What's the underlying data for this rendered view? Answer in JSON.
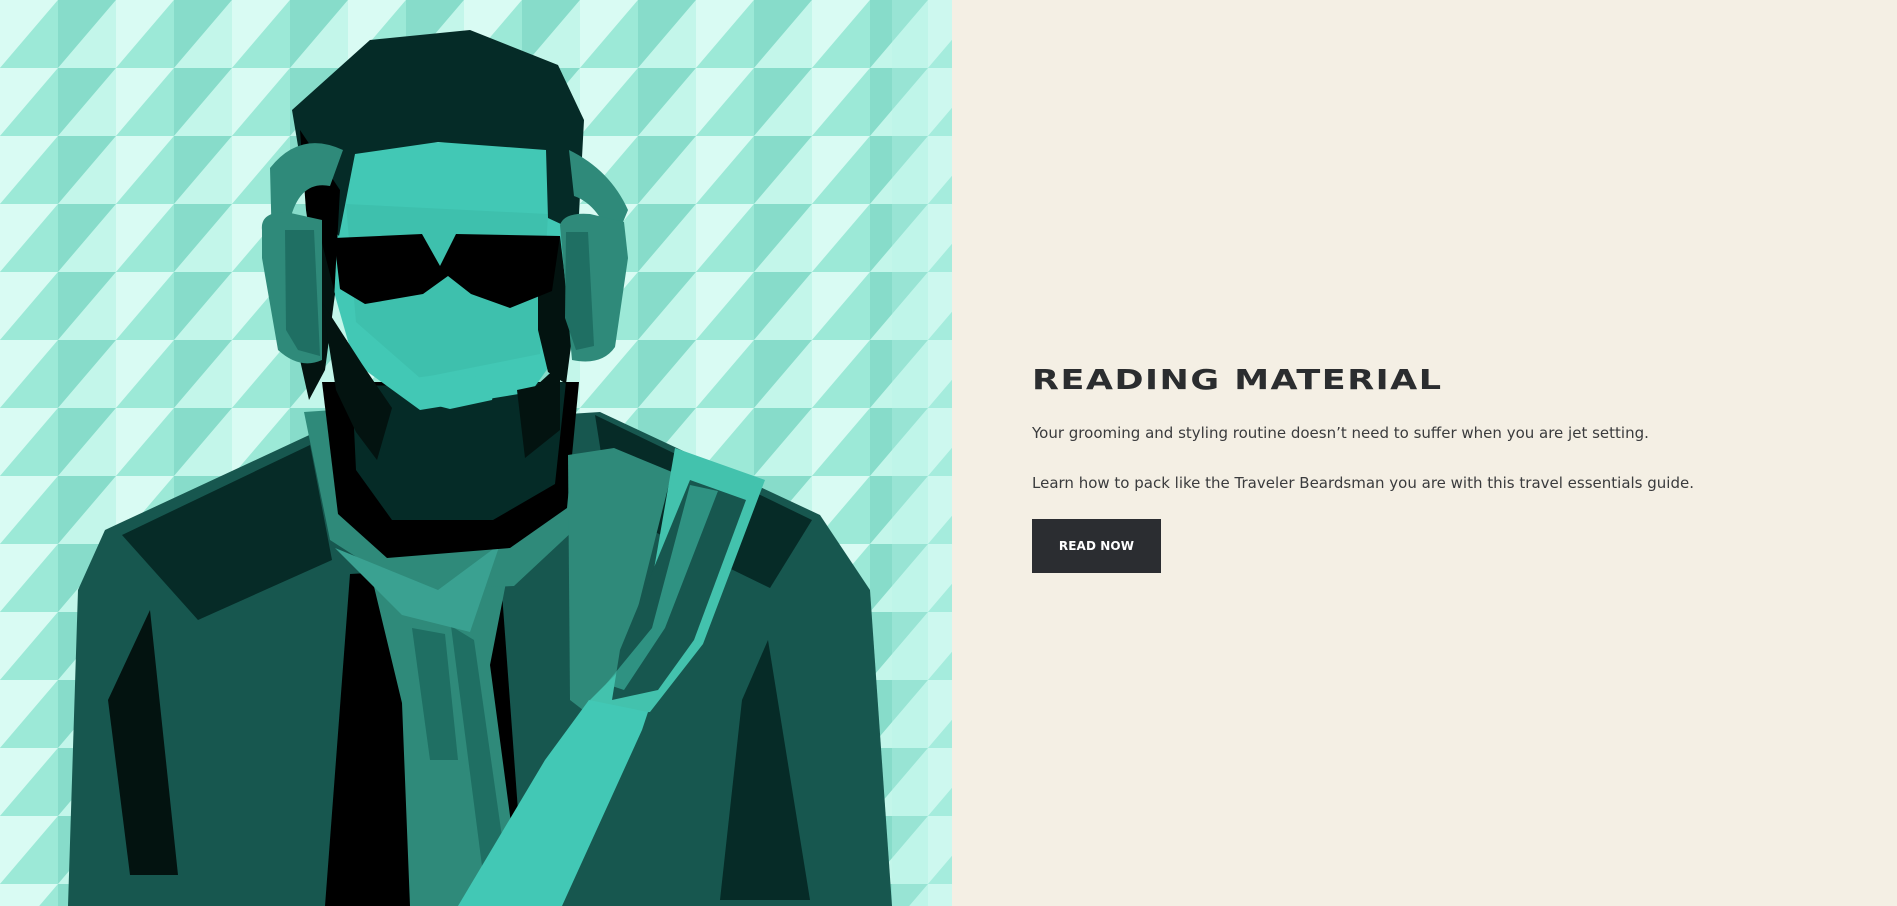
{
  "hero": {
    "image": {
      "subject": "illustrated-bearded-man-with-headphones"
    },
    "headline": "READING MATERIAL",
    "body": [
      "Your grooming and styling routine doesn’t need to suffer when you are jet setting.",
      "Learn how to pack like the Traveler Beardsman you are with this travel essentials guide."
    ],
    "cta_label": "READ NOW"
  },
  "colors": {
    "page_background": "#f4efe4",
    "headline": "#2b2d2f",
    "body_text": "#3a3b3d",
    "button_background": "#2b2d31",
    "button_text": "#ffffff",
    "art_background_light": "#d9fbf3",
    "art_background_mid": "#aef0e0",
    "art_background_dark": "#87dcca",
    "figure_dark": "#052b27",
    "figure_jacket": "#17574f",
    "figure_skin": "#42c8b5",
    "figure_scarf": "#2f8a7a",
    "figure_strap": "#43c2ad"
  }
}
